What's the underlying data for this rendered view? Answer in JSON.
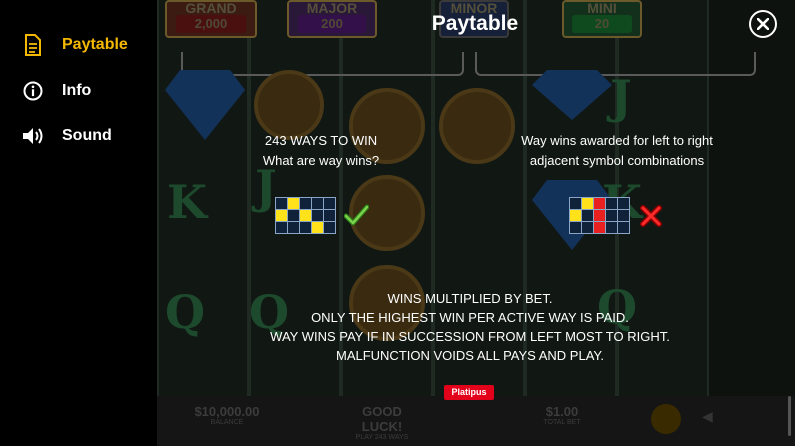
{
  "menu": {
    "items": [
      {
        "label": "Paytable",
        "icon": "document-icon",
        "active": true
      },
      {
        "label": "Info",
        "icon": "info-icon",
        "active": false
      },
      {
        "label": "Sound",
        "icon": "speaker-icon",
        "active": false
      }
    ],
    "active_color": "#f5b800"
  },
  "header": {
    "title": "Paytable"
  },
  "background": {
    "jackpots": [
      {
        "label": "GRAND",
        "value": "2,000",
        "color": "#5e0f0f"
      },
      {
        "label": "MAJOR",
        "value": "200",
        "color": "#3a0f5e"
      },
      {
        "label": "MINOR",
        "value": "",
        "color": "#0f2a5e"
      },
      {
        "label": "MINI",
        "value": "20",
        "color": "#0f4a1e"
      }
    ],
    "bottom_bar": {
      "balance_value": "$10,000.00",
      "balance_label": "BALANCE",
      "message_value": "GOOD LUCK!",
      "message_label": "PLAY 243 WAYS",
      "bet_value": "$1.00",
      "bet_label": "TOTAL BET"
    }
  },
  "ways": {
    "left_heading": "243 WAYS TO WIN",
    "left_subheading": "What are way wins?",
    "right_text_line1": "Way wins awarded for left to right",
    "right_text_line2": "adjacent symbol combinations",
    "valid_icon": "checkmark-icon",
    "invalid_icon": "cross-icon"
  },
  "rules": {
    "lines": [
      "WINS MULTIPLIED BY BET.",
      "ONLY THE HIGHEST WIN PER ACTIVE WAY IS PAID.",
      "WAY WINS PAY IF IN SUCCESSION FROM LEFT MOST TO RIGHT.",
      "MALFUNCTION VOIDS ALL PAYS AND PLAY."
    ]
  },
  "brand": {
    "logo_text": "Platipus"
  }
}
